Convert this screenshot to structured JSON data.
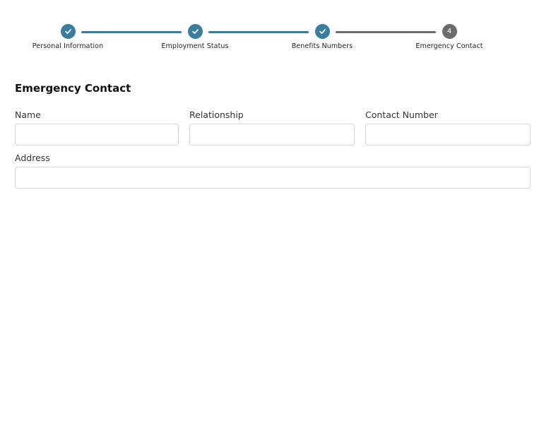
{
  "stepper": {
    "steps": [
      {
        "label": "Personal Information",
        "status": "completed",
        "icon": "check-icon"
      },
      {
        "label": "Employment Status",
        "status": "completed",
        "icon": "check-icon"
      },
      {
        "label": "Benefits Numbers",
        "status": "completed",
        "icon": "check-icon"
      },
      {
        "label": "Emergency Contact",
        "status": "active",
        "number": "4"
      }
    ],
    "colors": {
      "completed": "#3b7d9c",
      "active": "#6b6b6b",
      "line_completed": "#3b7d9c",
      "line_pending": "#6b6b6b"
    }
  },
  "section": {
    "title": "Emergency Contact"
  },
  "form": {
    "name": {
      "label": "Name",
      "value": "",
      "placeholder": ""
    },
    "relationship": {
      "label": "Relationship",
      "value": "",
      "placeholder": ""
    },
    "contact_number": {
      "label": "Contact Number",
      "value": "",
      "placeholder": ""
    },
    "address": {
      "label": "Address",
      "value": "",
      "placeholder": ""
    }
  }
}
